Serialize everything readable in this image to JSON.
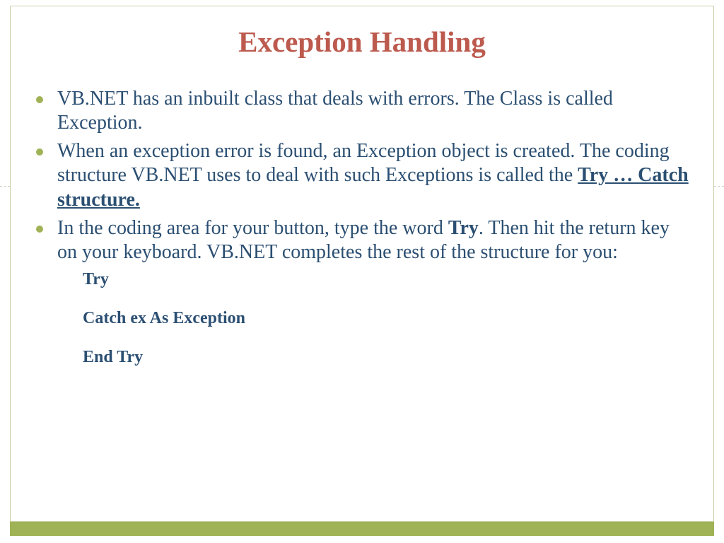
{
  "title": "Exception Handling",
  "bullets": {
    "b1": "VB.NET has an inbuilt class that deals with errors. The Class is called Exception.",
    "b2_pre": "When an exception error is found, an Exception object is created. The coding structure VB.NET uses to deal with such Exceptions is called the ",
    "b2_emph": "Try … Catch structure.",
    "b3_pre": "In the coding area for your button, type the word ",
    "b3_bold": "Try",
    "b3_post": ". Then hit the return key on your keyboard. VB.NET completes the rest of the structure for you:"
  },
  "code": {
    "l1": "Try",
    "l2": "Catch ex As Exception",
    "l3": "End Try"
  }
}
